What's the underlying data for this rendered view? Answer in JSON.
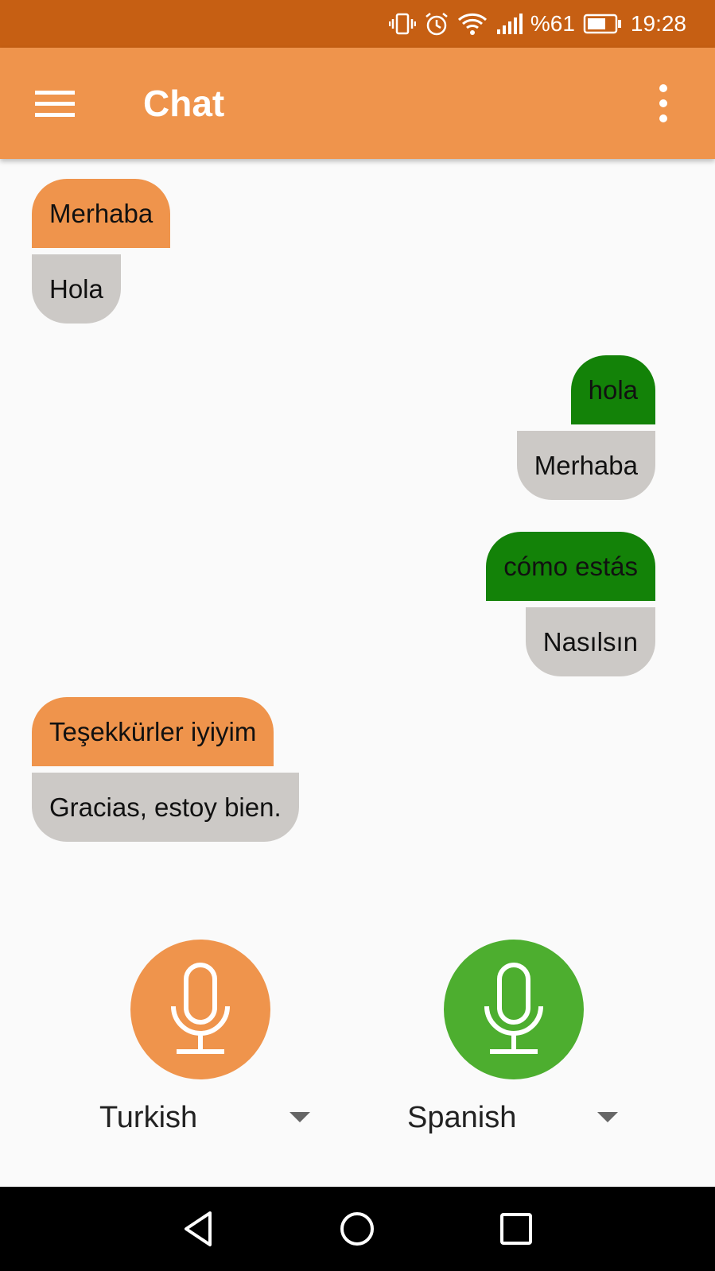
{
  "status_bar": {
    "battery": "%61",
    "time": "19:28"
  },
  "app_bar": {
    "title": "Chat"
  },
  "messages": [
    {
      "original": "Merhaba",
      "translation": "Hola"
    },
    {
      "original": "hola",
      "translation": "Merhaba"
    },
    {
      "original": "cómo estás",
      "translation": "Nasılsın"
    },
    {
      "original": "Teşekkürler iyiyim",
      "translation": "Gracias, estoy bien."
    }
  ],
  "languages": {
    "left": "Turkish",
    "right": "Spanish"
  },
  "colors": {
    "status_bar": "#c65f13",
    "app_bar": "#ef944c",
    "turkish_bubble": "#ef944c",
    "spanish_bubble": "#138208",
    "translation_bubble": "#ccc9c6",
    "spanish_mic": "#4dae2f"
  },
  "icons": [
    "vibrate-icon",
    "alarm-icon",
    "wifi-icon",
    "signal-icon",
    "battery-icon",
    "menu-icon",
    "more-vert-icon",
    "microphone-icon",
    "back-icon",
    "home-icon",
    "recents-icon",
    "dropdown-caret-icon"
  ]
}
